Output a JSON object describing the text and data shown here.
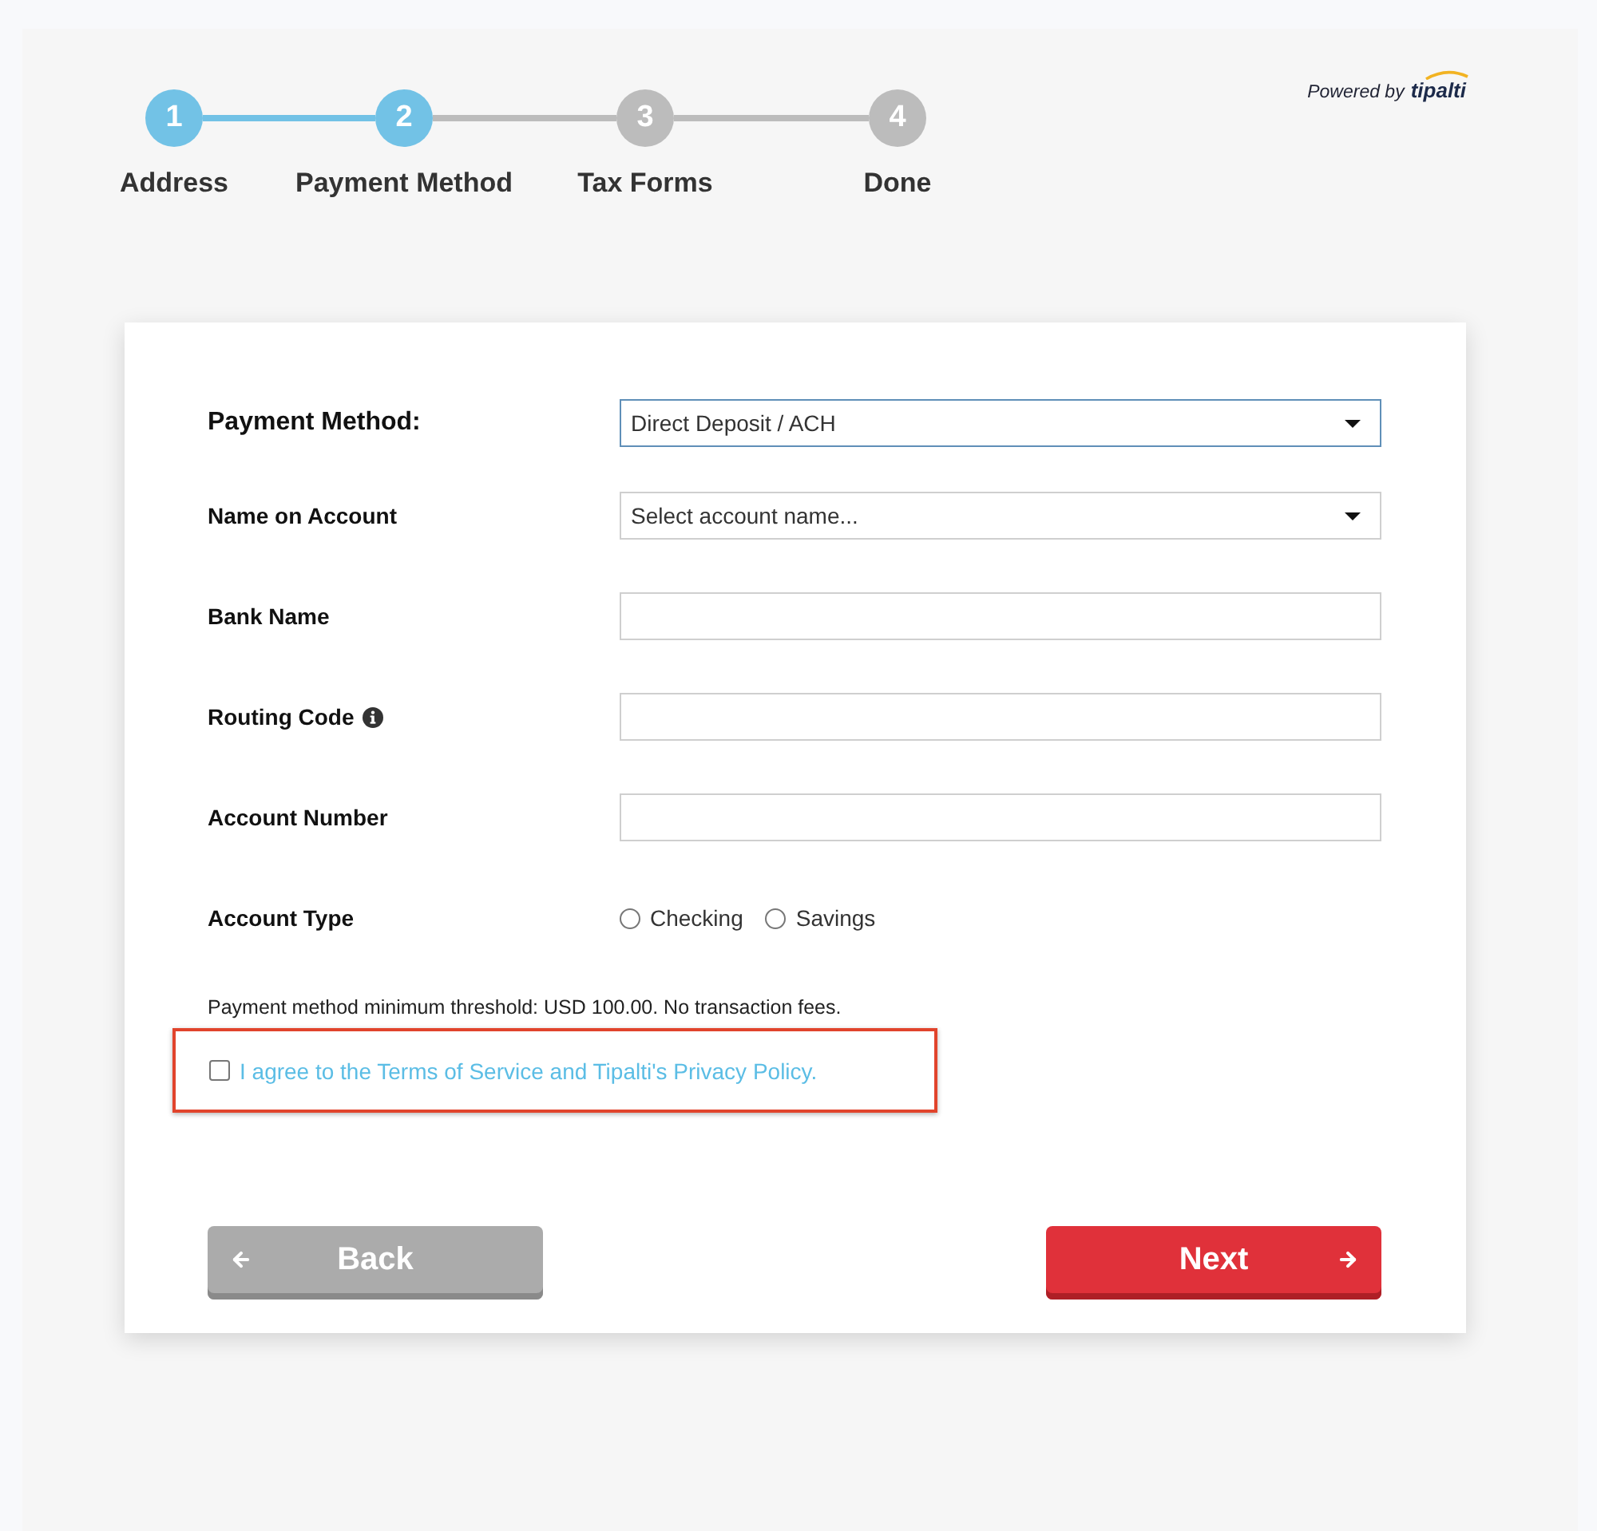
{
  "brand": {
    "prefix": "Powered by",
    "name": "tipalti"
  },
  "steps": [
    {
      "number": "1",
      "label": "Address",
      "reached": true
    },
    {
      "number": "2",
      "label": "Payment Method",
      "reached": true
    },
    {
      "number": "3",
      "label": "Tax Forms",
      "reached": false
    },
    {
      "number": "4",
      "label": "Done",
      "reached": false
    }
  ],
  "form": {
    "fields": [
      {
        "kind": "select",
        "label": "Payment Method:",
        "value": "Direct Deposit / ACH",
        "focused": true
      },
      {
        "kind": "select",
        "label": "Name on Account",
        "placeholder": "Select account name...",
        "focused": false
      },
      {
        "kind": "text",
        "label": "Bank Name",
        "focused": false
      },
      {
        "kind": "text",
        "label": "Routing Code",
        "info": true,
        "focused": false
      },
      {
        "kind": "text",
        "label": "Account Number",
        "focused": false
      },
      {
        "kind": "radio",
        "label": "Account Type",
        "options": [
          {
            "label": "Checking",
            "selected": false
          },
          {
            "label": "Savings",
            "selected": false
          }
        ]
      }
    ],
    "note": "Payment method minimum threshold: USD 100.00. No transaction fees.",
    "agreement": {
      "label": "I agree to the Terms of Service and Tipalti's Privacy Policy.",
      "checked": false,
      "highlighted": true
    }
  },
  "buttons": [
    {
      "kind": "back",
      "label": "Back"
    },
    {
      "kind": "next",
      "label": "Next"
    }
  ]
}
